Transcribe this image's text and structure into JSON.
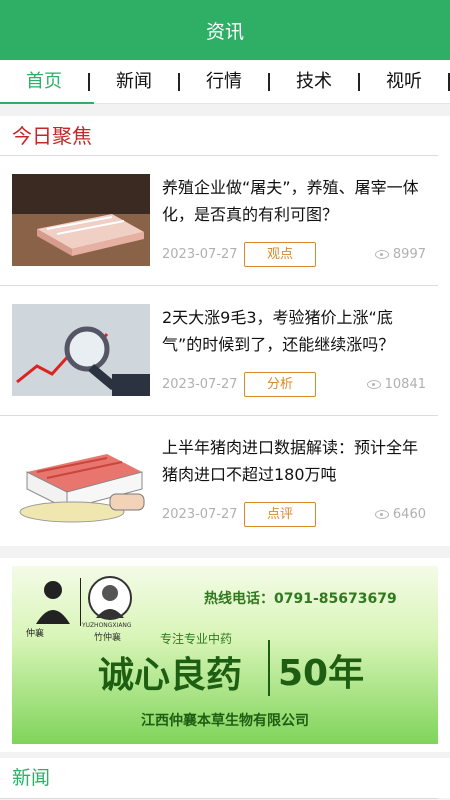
{
  "header": {
    "title": "资讯"
  },
  "tabs": [
    {
      "label": "首页"
    },
    {
      "label": "新闻"
    },
    {
      "label": "行情"
    },
    {
      "label": "技术"
    },
    {
      "label": "视听"
    }
  ],
  "focus": {
    "title": "今日聚焦",
    "items": [
      {
        "title": "养殖企业做“屠夫”，养殖、屠宰一体化，是否真的有利可图？",
        "date": "2023-07-27",
        "tag": "观点",
        "views": "8997"
      },
      {
        "title": "2天大涨9毛3，考验猪价上涨“底气”的时候到了，还能继续涨吗？",
        "date": "2023-07-27",
        "tag": "分析",
        "views": "10841"
      },
      {
        "title": "上半年猪肉进口数据解读：预计全年猪肉进口不超过180万吨",
        "date": "2023-07-27",
        "tag": "点评",
        "views": "6460"
      }
    ]
  },
  "banner": {
    "hotline": "热线电话：0791-85673679",
    "slogan_small": "专注专业中药",
    "slogan_big": "诚心良药",
    "years": "50年",
    "company": "江西仲襄本草生物有限公司",
    "logo_left": "仲襄",
    "logo_right": "YUZHONGXIANG",
    "logo_right_cn": "竹仲襄"
  },
  "news_section": {
    "title": "新闻"
  },
  "colors": {
    "brand": "#2fae66",
    "focus_title": "#c52727",
    "tag": "#d9882c"
  }
}
